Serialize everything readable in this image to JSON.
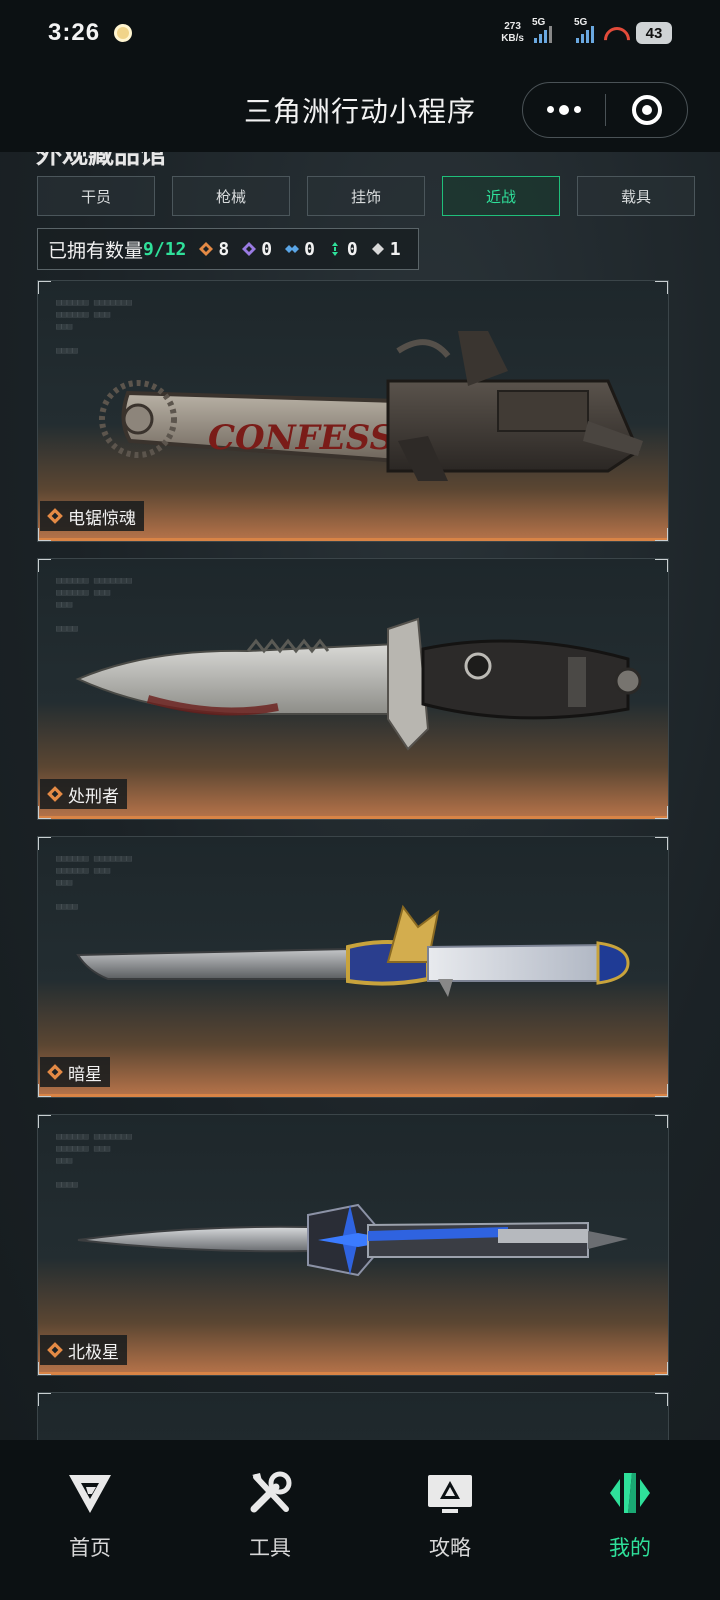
{
  "status_bar": {
    "time": "3:26",
    "net_speed_value": "273",
    "net_speed_unit": "KB/s",
    "signal1_label": "5G",
    "signal2_label": "5G",
    "battery": "43"
  },
  "header": {
    "title": "三角洲行动小程序"
  },
  "section": {
    "title": "外观藏品馆"
  },
  "tabs": [
    {
      "label": "干员",
      "active": false
    },
    {
      "label": "枪械",
      "active": false
    },
    {
      "label": "挂饰",
      "active": false
    },
    {
      "label": "近战",
      "active": true
    },
    {
      "label": "载具",
      "active": false
    }
  ],
  "owned": {
    "label": "已拥有数量",
    "count": "9/12",
    "orange": "8",
    "purple": "0",
    "blue": "0",
    "green": "0",
    "white": "1"
  },
  "items": [
    {
      "name": "电锯惊魂",
      "rarity_color": "#e48a45"
    },
    {
      "name": "处刑者",
      "rarity_color": "#e48a45"
    },
    {
      "name": "暗星",
      "rarity_color": "#e48a45"
    },
    {
      "name": "北极星",
      "rarity_color": "#e48a45"
    }
  ],
  "nav": [
    {
      "label": "首页",
      "icon": "home-logo-icon",
      "active": false
    },
    {
      "label": "工具",
      "icon": "tools-icon",
      "active": false
    },
    {
      "label": "攻略",
      "icon": "guide-monitor-icon",
      "active": false
    },
    {
      "label": "我的",
      "icon": "profile-logo-icon",
      "active": true
    }
  ],
  "colors": {
    "accent_green": "#2fe09a",
    "orange_rarity": "#e48a45",
    "background": "#1b2226"
  }
}
